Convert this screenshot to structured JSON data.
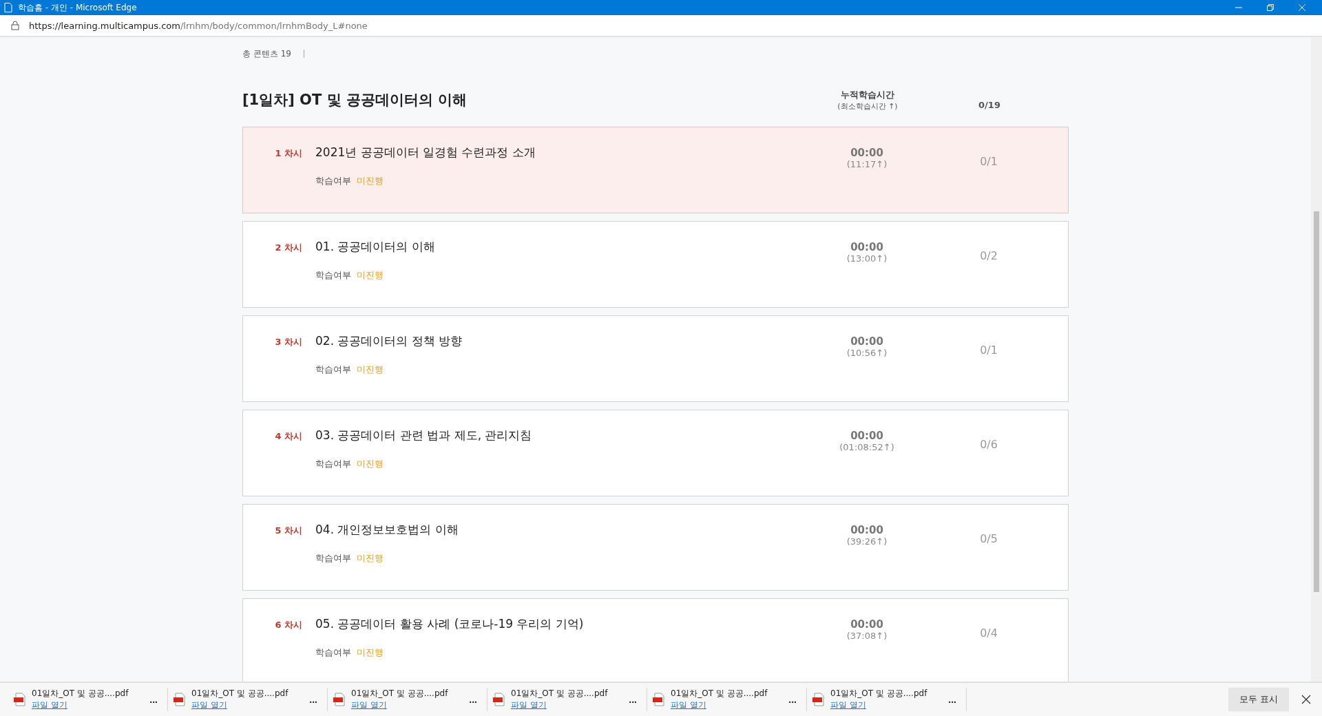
{
  "window": {
    "title": "학습홈 - 개인 - Microsoft Edge"
  },
  "address_bar": {
    "url_host": "https://learning.multicampus.com",
    "url_path": "/lrnhm/body/common/lrnhmBody_L#none"
  },
  "summary": {
    "total_contents": "총 콘텐츠 19"
  },
  "section": {
    "title": "[1일차] OT 및 공공데이터의 이해",
    "time_header": "누적학습시간",
    "time_subheader": "(최소학습시간 ↑)",
    "progress": "0/19"
  },
  "lessons": [
    {
      "number": "1 차시",
      "title": "2021년 공공데이터 일경험 수련과정 소개",
      "status_label": "학습여부",
      "status": "미진행",
      "time": "00:00",
      "min_time": "(11:17↑)",
      "progress": "0/1",
      "selected": true
    },
    {
      "number": "2 차시",
      "title": "01. 공공데이터의 이해",
      "status_label": "학습여부",
      "status": "미진행",
      "time": "00:00",
      "min_time": "(13:00↑)",
      "progress": "0/2",
      "selected": false
    },
    {
      "number": "3 차시",
      "title": "02. 공공데이터의 정책 방향",
      "status_label": "학습여부",
      "status": "미진행",
      "time": "00:00",
      "min_time": "(10:56↑)",
      "progress": "0/1",
      "selected": false
    },
    {
      "number": "4 차시",
      "title": "03. 공공데이터 관련 법과 제도, 관리지침",
      "status_label": "학습여부",
      "status": "미진행",
      "time": "00:00",
      "min_time": "(01:08:52↑)",
      "progress": "0/6",
      "selected": false
    },
    {
      "number": "5 차시",
      "title": "04. 개인정보보호법의 이해",
      "status_label": "학습여부",
      "status": "미진행",
      "time": "00:00",
      "min_time": "(39:26↑)",
      "progress": "0/5",
      "selected": false
    },
    {
      "number": "6 차시",
      "title": "05. 공공데이터 활용 사례 (코로나-19 우리의 기억)",
      "status_label": "학습여부",
      "status": "미진행",
      "time": "00:00",
      "min_time": "(37:08↑)",
      "progress": "0/4",
      "selected": false
    }
  ],
  "downloads": [
    {
      "file": "01일차_OT 및 공공....pdf",
      "action": "파일 열기",
      "more": "..."
    },
    {
      "file": "01일차_OT 및 공공....pdf",
      "action": "파일 열기",
      "more": "..."
    },
    {
      "file": "01일차_OT 및 공공....pdf",
      "action": "파일 열기",
      "more": "..."
    },
    {
      "file": "01일차_OT 및 공공....pdf",
      "action": "파일 열기",
      "more": "..."
    },
    {
      "file": "01일차_OT 및 공공....pdf",
      "action": "파일 열기",
      "more": "..."
    },
    {
      "file": "01일차_OT 및 공공....pdf",
      "action": "파일 열기",
      "more": "..."
    }
  ],
  "download_bar": {
    "show_all": "모두 표시"
  }
}
